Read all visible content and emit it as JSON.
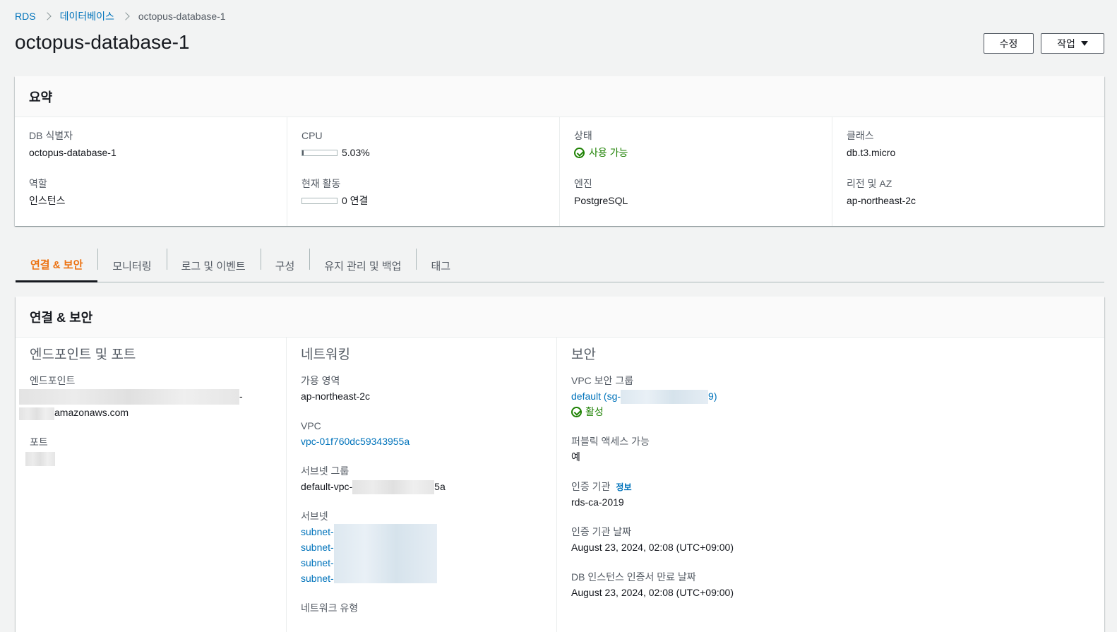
{
  "breadcrumb": {
    "rds": "RDS",
    "databases": "데이터베이스",
    "current": "octopus-database-1"
  },
  "page": {
    "title": "octopus-database-1"
  },
  "actions": {
    "edit": "수정",
    "actions": "작업"
  },
  "summary": {
    "title": "요약",
    "db_identifier_label": "DB 식별자",
    "db_identifier": "octopus-database-1",
    "role_label": "역할",
    "role": "인스턴스",
    "cpu_label": "CPU",
    "cpu": "5.03%",
    "cpu_fraction": 0.0503,
    "activity_label": "현재 활동",
    "activity": "0 연결",
    "activity_fraction": 0,
    "status_label": "상태",
    "status": "사용 가능",
    "engine_label": "엔진",
    "engine": "PostgreSQL",
    "class_label": "클래스",
    "class": "db.t3.micro",
    "region_label": "리전 및 AZ",
    "region": "ap-northeast-2c"
  },
  "tabs": [
    {
      "label": "연결 & 보안"
    },
    {
      "label": "모니터링"
    },
    {
      "label": "로그 및 이벤트"
    },
    {
      "label": "구성"
    },
    {
      "label": "유지 관리 및 백업"
    },
    {
      "label": "태그"
    }
  ],
  "connectivity": {
    "title": "연결 & 보안",
    "endpoint_section": {
      "title": "엔드포인트 및 포트",
      "endpoint_label": "엔드포인트",
      "endpoint_line1_suffix": "-",
      "endpoint_line2_suffix": "amazonaws.com",
      "port_label": "포트"
    },
    "network_section": {
      "title": "네트워킹",
      "az_label": "가용 영역",
      "az": "ap-northeast-2c",
      "vpc_label": "VPC",
      "vpc": "vpc-01f760dc59343955a",
      "subnet_group_label": "서브넷 그룹",
      "subnet_group_prefix": "default-vpc-",
      "subnet_group_suffix": "5a",
      "subnets_label": "서브넷",
      "subnet_prefix": "subnet-",
      "network_type_label": "네트워크 유형"
    },
    "security_section": {
      "title": "보안",
      "vpc_sg_label": "VPC 보안 그룹",
      "vpc_sg_prefix": "default (sg-",
      "vpc_sg_suffix": "9)",
      "vpc_sg_status": "활성",
      "public_label": "퍼블릭 액세스 가능",
      "public": "예",
      "ca_label": "인증 기관",
      "ca_info": "정보",
      "ca": "rds-ca-2019",
      "ca_date_label": "인증 기관 날짜",
      "ca_date": "August 23, 2024, 02:08 (UTC+09:00)",
      "cert_expiry_label": "DB 인스턴스 인증서 만료 날짜",
      "cert_expiry": "August 23, 2024, 02:08 (UTC+09:00)"
    }
  }
}
